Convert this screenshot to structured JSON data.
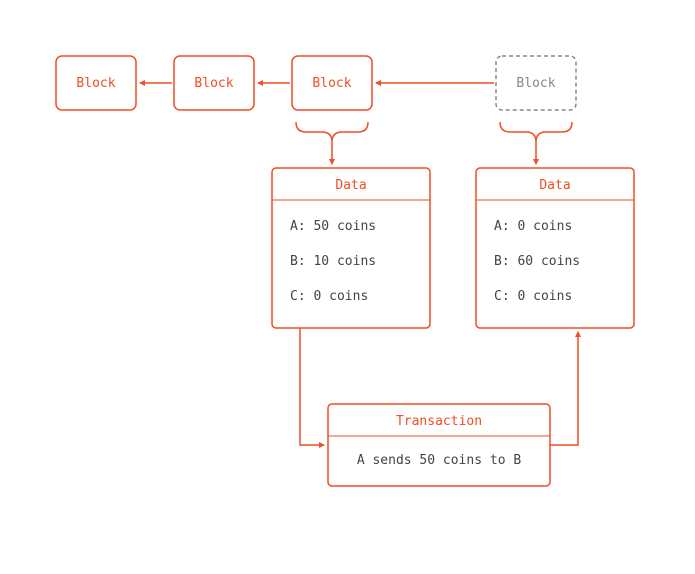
{
  "colors": {
    "accent": "#f04e23",
    "muted": "#888888",
    "text": "#444444"
  },
  "blocks": [
    {
      "label": "Block",
      "pending": false
    },
    {
      "label": "Block",
      "pending": false
    },
    {
      "label": "Block",
      "pending": false
    },
    {
      "label": "Block",
      "pending": true
    }
  ],
  "data_left": {
    "title": "Data",
    "lines": [
      "A: 50 coins",
      "B: 10 coins",
      "C: 0 coins"
    ]
  },
  "data_right": {
    "title": "Data",
    "lines": [
      "A: 0 coins",
      "B: 60 coins",
      "C: 0 coins"
    ]
  },
  "transaction": {
    "title": "Transaction",
    "body": "A sends 50 coins to B"
  }
}
